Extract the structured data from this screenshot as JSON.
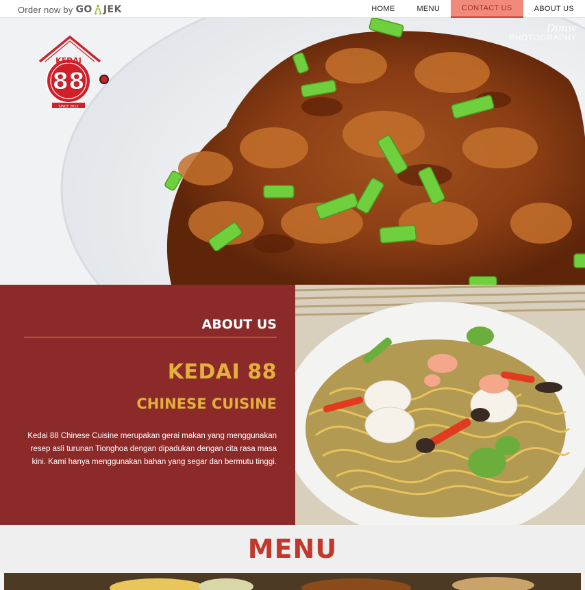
{
  "nav": {
    "promo_text": "Order now by",
    "promo_brand_go": "GO",
    "promo_brand_jek": "JEK",
    "promo_icon": "gojek-scooter-icon",
    "items": [
      {
        "label": "HOME",
        "active": false
      },
      {
        "label": "MENU",
        "active": false
      },
      {
        "label": "CONTACT US",
        "active": true
      },
      {
        "label": "ABOUT US",
        "active": false
      }
    ]
  },
  "hero": {
    "watermark_signature": "Dimw",
    "watermark_label": "PHOTOGRAPHY"
  },
  "logo": {
    "top_text": "KEDAI",
    "number": "88",
    "bottom_text": "SINCE 2012"
  },
  "about": {
    "title": "ABOUT US",
    "brand_name": "KEDAI 88",
    "brand_sub": "CHINESE CUISINE",
    "description": "Kedai 88 Chinese Cuisine merupakan gerai makan yang menggunakan resep asli turunan Tionghoa dengan dipadukan dengan cita rasa masa kini. Kami hanya menggunakan bahan yang segar dan bermutu tinggi."
  },
  "menu": {
    "title": "MENU"
  },
  "colors": {
    "accent_red": "#8c2a2a",
    "gold": "#e2b13c",
    "menu_title": "#c2382c",
    "nav_active_bg": "#f08a7a"
  }
}
